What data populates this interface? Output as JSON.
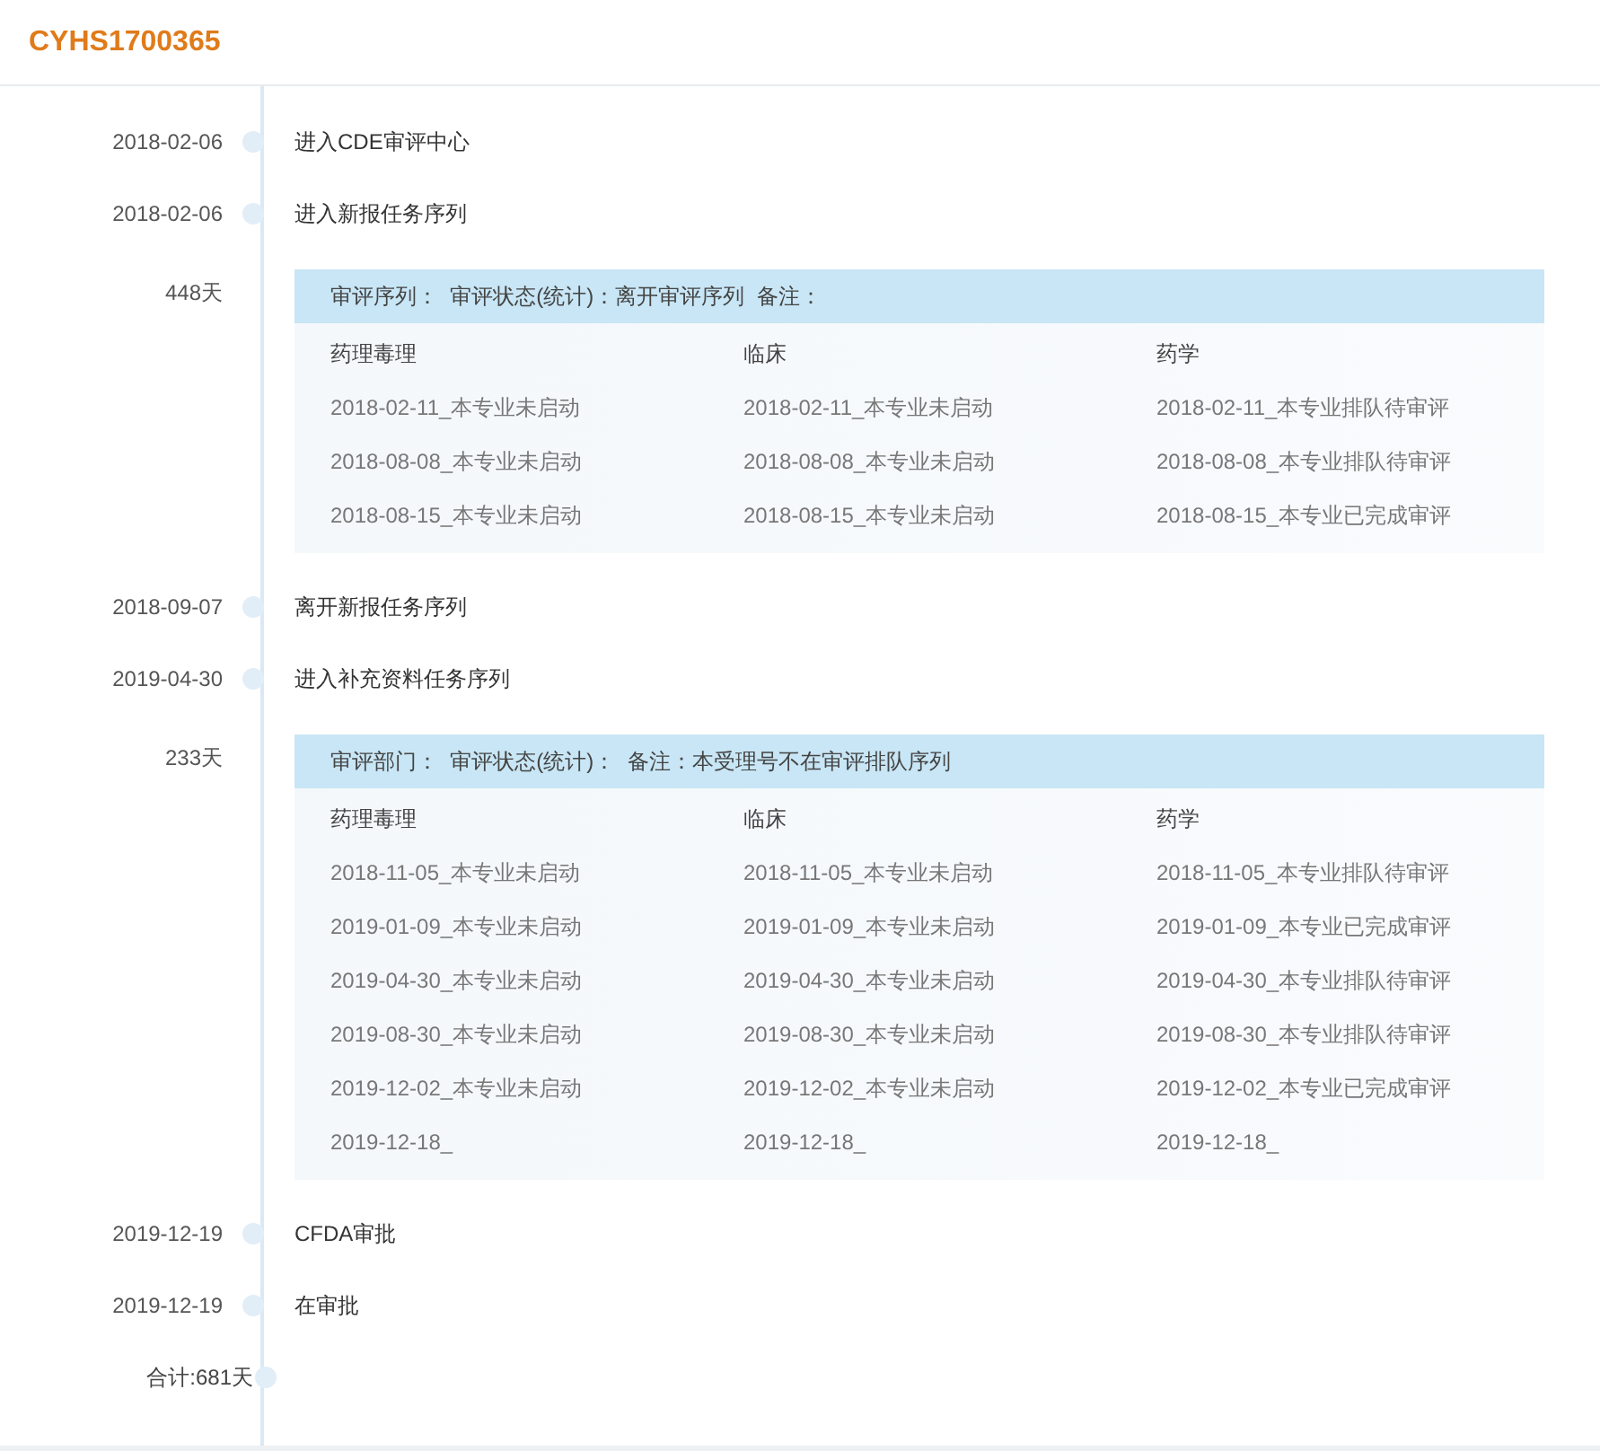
{
  "title": "CYHS1700365",
  "timeline": [
    {
      "kind": "event",
      "date": "2018-02-06",
      "label": "进入CDE审评中心"
    },
    {
      "kind": "event",
      "date": "2018-02-06",
      "label": "进入新报任务序列"
    },
    {
      "kind": "detail",
      "duration": "448天",
      "header": "审评序列：  审评状态(统计)：离开审评序列  备注：",
      "columns": [
        "药理毒理",
        "临床",
        "药学"
      ],
      "rows": [
        [
          "2018-02-11_本专业未启动",
          "2018-02-11_本专业未启动",
          "2018-02-11_本专业排队待审评"
        ],
        [
          "2018-08-08_本专业未启动",
          "2018-08-08_本专业未启动",
          "2018-08-08_本专业排队待审评"
        ],
        [
          "2018-08-15_本专业未启动",
          "2018-08-15_本专业未启动",
          "2018-08-15_本专业已完成审评"
        ]
      ]
    },
    {
      "kind": "event",
      "date": "2018-09-07",
      "label": "离开新报任务序列"
    },
    {
      "kind": "event",
      "date": "2019-04-30",
      "label": "进入补充资料任务序列"
    },
    {
      "kind": "detail",
      "duration": "233天",
      "header": "审评部门：  审评状态(统计)：  备注：本受理号不在审评排队序列",
      "columns": [
        "药理毒理",
        "临床",
        "药学"
      ],
      "rows": [
        [
          "2018-11-05_本专业未启动",
          "2018-11-05_本专业未启动",
          "2018-11-05_本专业排队待审评"
        ],
        [
          "2019-01-09_本专业未启动",
          "2019-01-09_本专业未启动",
          "2019-01-09_本专业已完成审评"
        ],
        [
          "2019-04-30_本专业未启动",
          "2019-04-30_本专业未启动",
          "2019-04-30_本专业排队待审评"
        ],
        [
          "2019-08-30_本专业未启动",
          "2019-08-30_本专业未启动",
          "2019-08-30_本专业排队待审评"
        ],
        [
          "2019-12-02_本专业未启动",
          "2019-12-02_本专业未启动",
          "2019-12-02_本专业已完成审评"
        ],
        [
          "2019-12-18_",
          "2019-12-18_",
          "2019-12-18_"
        ]
      ]
    },
    {
      "kind": "event",
      "date": "2019-12-19",
      "label": "CFDA审批"
    },
    {
      "kind": "event",
      "date": "2019-12-19",
      "label": "在审批"
    },
    {
      "kind": "total",
      "label": "合计:681天"
    }
  ]
}
